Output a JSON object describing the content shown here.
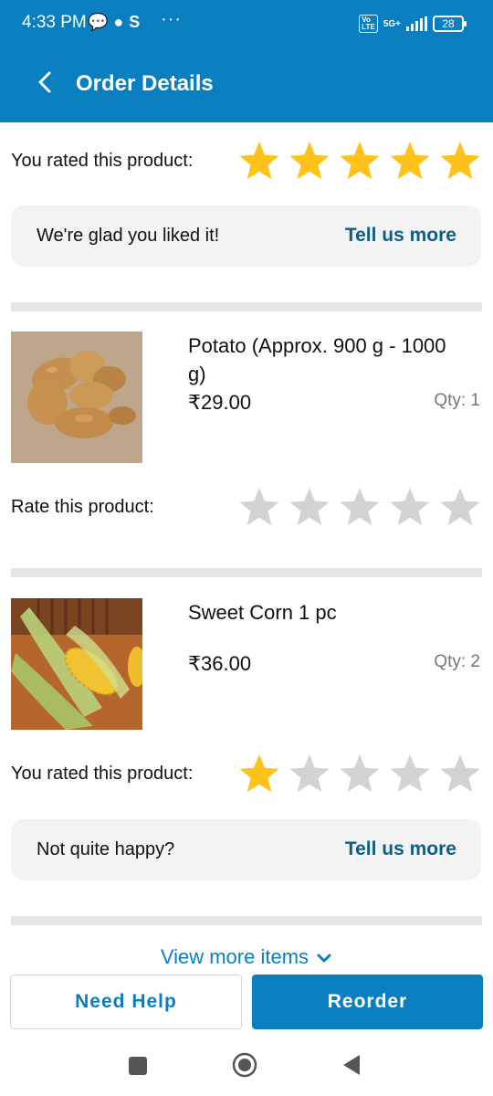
{
  "status_bar": {
    "time": "4:33 PM",
    "network": "5G+",
    "battery": "28"
  },
  "header": {
    "title": "Order Details"
  },
  "first_item_rating": {
    "label": "You rated this product:",
    "rating": 5,
    "max": 5,
    "feedback_message": "We're glad you liked it!",
    "feedback_link": "Tell us more"
  },
  "items": [
    {
      "name": "Potato (Approx. 900 g - 1000 g)",
      "price": "₹29.00",
      "qty": "Qty: 1",
      "rating_label": "Rate this product:",
      "rating": 0,
      "max": 5
    },
    {
      "name": "Sweet Corn 1 pc",
      "price": "₹36.00",
      "qty": "Qty: 2",
      "rating_label": "You rated this product:",
      "rating": 1,
      "max": 5,
      "feedback_message": "Not quite happy?",
      "feedback_link": "Tell us more"
    }
  ],
  "view_more": "View more items",
  "actions": {
    "help_label": "Need Help",
    "reorder_label": "Reorder"
  },
  "colors": {
    "brand": "#0a7fc0",
    "star_filled": "#ffc21a",
    "star_empty": "#d3d3d3",
    "link": "#0b5f88"
  }
}
